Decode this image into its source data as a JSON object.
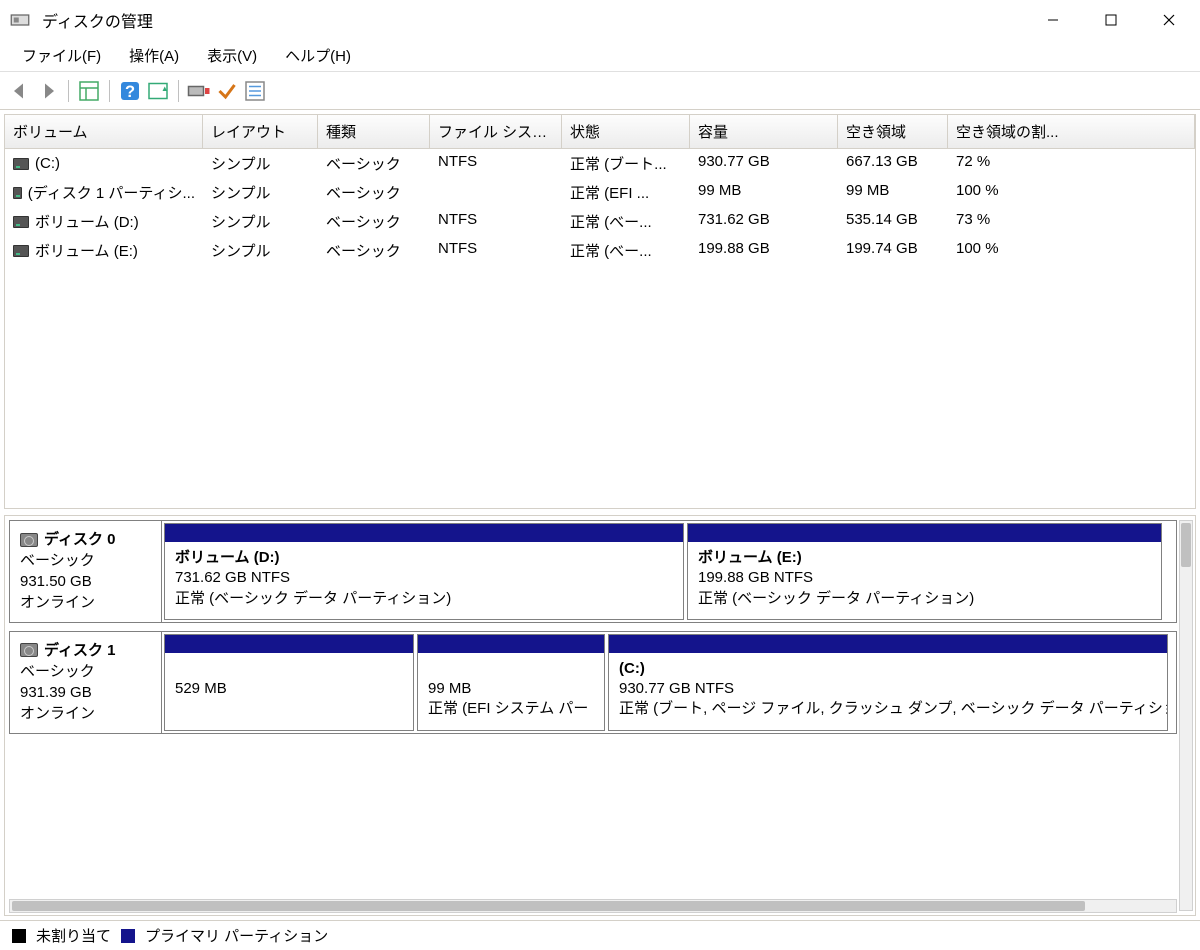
{
  "titlebar": {
    "title": "ディスクの管理"
  },
  "menubar": {
    "items": [
      {
        "label": "ファイル(F)"
      },
      {
        "label": "操作(A)"
      },
      {
        "label": "表示(V)"
      },
      {
        "label": "ヘルプ(H)"
      }
    ]
  },
  "toolbar": {
    "icons": [
      "back-icon",
      "forward-icon",
      "details-icon",
      "help-icon",
      "refresh-icon",
      "connection-icon",
      "check-icon",
      "list-icon"
    ]
  },
  "volumes": {
    "headers": [
      "ボリューム",
      "レイアウト",
      "種類",
      "ファイル システム",
      "状態",
      "容量",
      "空き領域",
      "空き領域の割..."
    ],
    "rows": [
      {
        "name": "(C:)",
        "layout": "シンプル",
        "type": "ベーシック",
        "fs": "NTFS",
        "status": "正常 (ブート...",
        "capacity": "930.77 GB",
        "free": "667.13 GB",
        "pct": "72 %"
      },
      {
        "name": "(ディスク 1 パーティシ...",
        "layout": "シンプル",
        "type": "ベーシック",
        "fs": "",
        "status": "正常 (EFI ...",
        "capacity": "99 MB",
        "free": "99 MB",
        "pct": "100 %"
      },
      {
        "name": "ボリューム (D:)",
        "layout": "シンプル",
        "type": "ベーシック",
        "fs": "NTFS",
        "status": "正常 (べー...",
        "capacity": "731.62 GB",
        "free": "535.14 GB",
        "pct": "73 %"
      },
      {
        "name": "ボリューム (E:)",
        "layout": "シンプル",
        "type": "ベーシック",
        "fs": "NTFS",
        "status": "正常 (べー...",
        "capacity": "199.88 GB",
        "free": "199.74 GB",
        "pct": "100 %"
      }
    ]
  },
  "disks": [
    {
      "name": "ディスク 0",
      "type": "ベーシック",
      "size": "931.50 GB",
      "status": "オンライン",
      "partitions": [
        {
          "label": "ボリューム  (D:)",
          "info1": "731.62 GB NTFS",
          "info2": "正常 (ベーシック データ パーティション)",
          "flex": 520
        },
        {
          "label": "ボリューム  (E:)",
          "info1": "199.88 GB NTFS",
          "info2": "正常 (ベーシック データ パーティション)",
          "flex": 475,
          "highlight": true
        }
      ]
    },
    {
      "name": "ディスク 1",
      "type": "ベーシック",
      "size": "931.39 GB",
      "status": "オンライン",
      "partitions": [
        {
          "label": "",
          "info1": "529 MB",
          "info2": "",
          "flex": 250
        },
        {
          "label": "",
          "info1": "99 MB",
          "info2": "正常 (EFI システム パー",
          "flex": 188
        },
        {
          "label": " (C:)",
          "info1": "930.77 GB NTFS",
          "info2": "正常 (ブート, ページ ファイル, クラッシュ ダンプ, ベーシック データ パーティショ",
          "flex": 560
        }
      ]
    }
  ],
  "legend": {
    "unallocated": "未割り当て",
    "primary": "プライマリ パーティション"
  }
}
